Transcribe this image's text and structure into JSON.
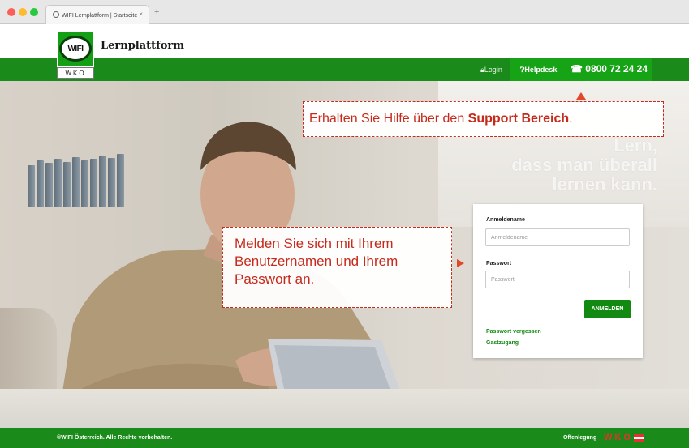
{
  "browser": {
    "tab_title": "WIFI Lernplattform | Startseite",
    "tab_close": "×",
    "new_tab": "+"
  },
  "header": {
    "logo_text": "WIFI",
    "logo_subtext": "WKO",
    "brand": "Lernplattform"
  },
  "nav": {
    "login_label": "Login",
    "helpdesk_label": "Helpdesk",
    "phone": "0800 72 24 24"
  },
  "hero": {
    "tagline_lines": [
      "Lern,",
      "dass man überall",
      "lernen kann."
    ]
  },
  "login": {
    "username_label": "Anmeldename",
    "username_placeholder": "Anmeldename",
    "password_label": "Passwort",
    "password_placeholder": "Passwort",
    "submit_label": "ANMELDEN",
    "forgot_password": "Passwort vergessen",
    "guest_access": "Gastzugang"
  },
  "annotations": {
    "support_text_prefix": "Erhalten Sie Hilfe über den ",
    "support_text_bold": "Support Bereich",
    "support_text_suffix": ".",
    "login_text": "Melden Sie sich mit Ihrem Benutzernamen und Ihrem Passwort an.",
    "accent_color": "#c62a1c"
  },
  "footer": {
    "copyright": "©WIFI Österreich. Alle Rechte vorbehalten.",
    "imprint": "Offenlegung",
    "logo_text": "WKO"
  },
  "colors": {
    "brand_green": "#1a8a1a",
    "helpdesk_green": "#16a316"
  }
}
